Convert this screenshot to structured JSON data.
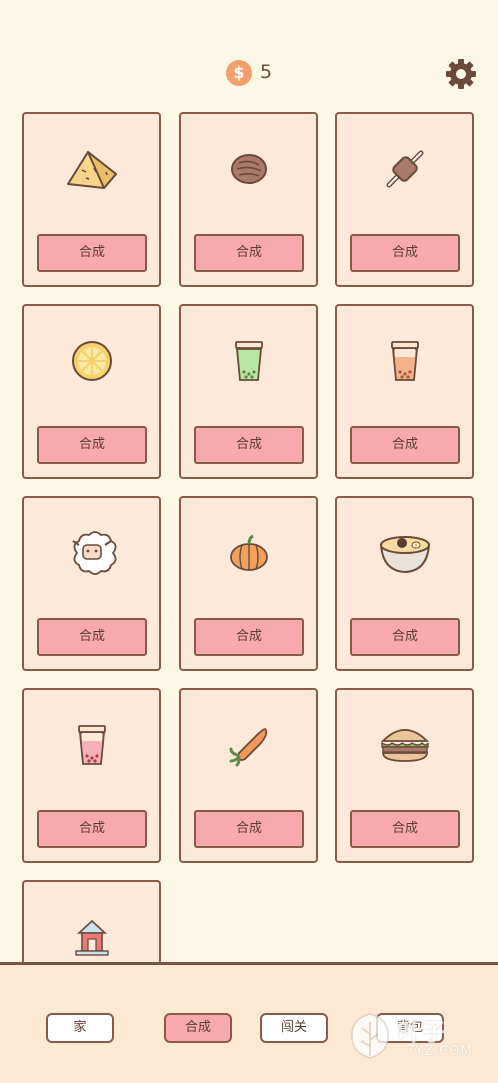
{
  "header": {
    "coin_symbol": "$",
    "coin_count": "5",
    "settings_icon": "gear-icon"
  },
  "cards": [
    {
      "item": "cheese-wedge-icon",
      "button": "合成"
    },
    {
      "item": "steak-icon",
      "button": "合成"
    },
    {
      "item": "meat-skewer-icon",
      "button": "合成"
    },
    {
      "item": "lemon-slice-icon",
      "button": "合成"
    },
    {
      "item": "matcha-bubble-tea-icon",
      "button": "合成"
    },
    {
      "item": "orange-bubble-tea-icon",
      "button": "合成"
    },
    {
      "item": "sheep-icon",
      "button": "合成"
    },
    {
      "item": "pumpkin-icon",
      "button": "合成"
    },
    {
      "item": "ramen-bowl-icon",
      "button": "合成"
    },
    {
      "item": "strawberry-bubble-tea-icon",
      "button": "合成"
    },
    {
      "item": "carrot-icon",
      "button": "合成"
    },
    {
      "item": "sandwich-icon",
      "button": "合成"
    },
    {
      "item": "house-icon",
      "button": ""
    }
  ],
  "nav": {
    "tabs": [
      {
        "label": "家",
        "active": false
      },
      {
        "label": "合成",
        "active": true
      },
      {
        "label": "闯关",
        "active": false
      },
      {
        "label": "背包",
        "active": false
      }
    ]
  },
  "watermark": {
    "text": "叶子",
    "sub": "7YZ.COM"
  },
  "colors": {
    "background": "#fdf7e6",
    "card": "#fde9da",
    "border": "#8a5a48",
    "button": "#f8a9ae",
    "coin": "#f2a06b"
  }
}
